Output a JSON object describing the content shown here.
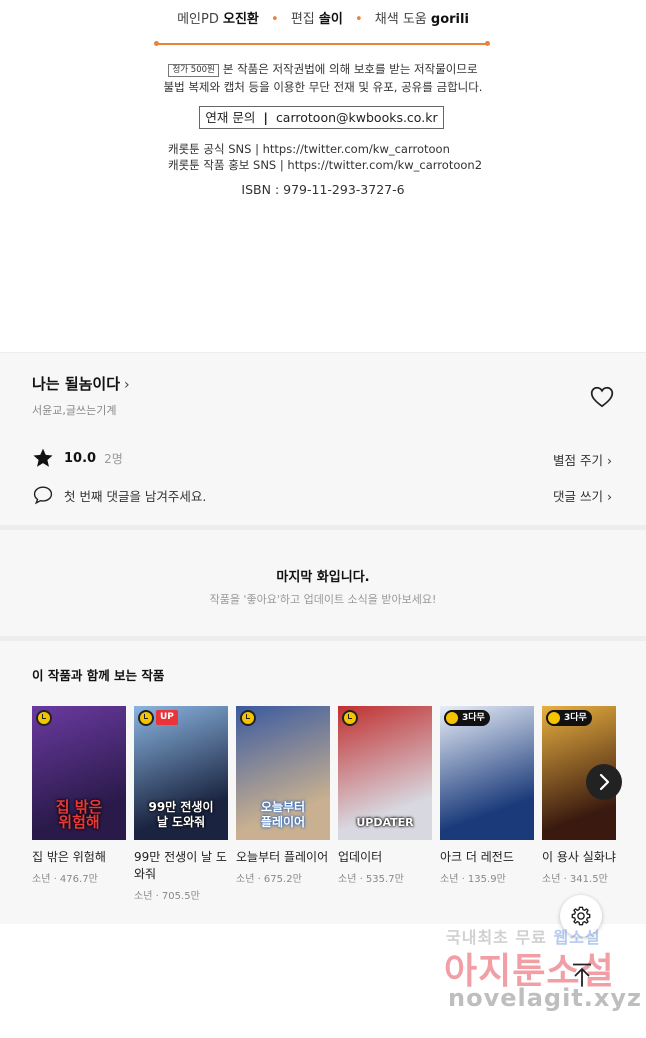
{
  "credits": {
    "pd_label": "메인PD",
    "pd_name": "오진환",
    "editor_label": "편집",
    "editor_name": "솔이",
    "color_label": "채색 도움",
    "color_name": "gorili",
    "price": "정가 500원",
    "notice_line1": "본 작품은 저작권법에 의해 보호를 받는 저작물이므로",
    "notice_line2": "불법 복제와 캡처 등을 이용한 무단 전재 및 유포, 공유를 금합니다.",
    "contact_label": "연재 문의",
    "contact_sep": "|",
    "contact_email": "carrotoon@kwbooks.co.kr",
    "sns1": "캐롯툰 공식 SNS | https://twitter.com/kw_carrotoon",
    "sns2": "캐롯툰 작품 홍보 SNS | https://twitter.com/kw_carrotoon2",
    "isbn": "ISBN : 979-11-293-3727-6",
    "accent_color": "#e8843a"
  },
  "work": {
    "title": "나는 될놈이다",
    "authors": "서윤교,글쓰는기계",
    "score": "10.0",
    "raters": "2명",
    "rate_link": "별점 주기",
    "comment_prompt": "첫 번째 댓글을 남겨주세요.",
    "comment_link": "댓글 쓰기"
  },
  "last_episode": {
    "title": "마지막 화입니다.",
    "subtitle": "작품을 '좋아요'하고 업데이트 소식을 받아보세요!"
  },
  "recommendations": {
    "title": "이 작품과 함께 보는 작품",
    "items": [
      {
        "name": "집 밖은 위험해",
        "meta": "소년 · 476.7만",
        "badge": "clock",
        "cover": "집 밖은\n위험해",
        "colors": [
          "#2a1a4a",
          "#6a3aa0"
        ]
      },
      {
        "name": "99만 전생이 날 도와줘",
        "meta": "소년 · 705.5만",
        "badge": "up",
        "up_label": "UP",
        "cover": "99만 전생이\n날 도와줘",
        "colors": [
          "#1a2440",
          "#8ab4e0"
        ]
      },
      {
        "name": "오늘부터 플레이어",
        "meta": "소년 · 675.2만",
        "badge": "clock",
        "cover": "오늘부터\n플레이어",
        "colors": [
          "#c8b090",
          "#3a5aa0"
        ]
      },
      {
        "name": "업데이터",
        "meta": "소년 · 535.7만",
        "badge": "clock",
        "cover": "UPDATER",
        "colors": [
          "#d8d8e0",
          "#c03030"
        ]
      },
      {
        "name": "아크 더 레전드",
        "meta": "소년 · 135.9만",
        "badge": "3days",
        "badge_label": "3다무",
        "cover": "",
        "colors": [
          "#1a3a7a",
          "#e8eef8"
        ]
      },
      {
        "name": "이 용사 실화냐",
        "meta": "소년 · 341.5만",
        "badge": "3days",
        "badge_label": "3다무",
        "cover": "",
        "colors": [
          "#3a1a10",
          "#e8b040"
        ]
      }
    ]
  },
  "watermark": {
    "line1_a": "국내최초 무료",
    "line1_b": "웹소설",
    "line2": "아지툰소설",
    "line3": "novelagit.xyz"
  }
}
